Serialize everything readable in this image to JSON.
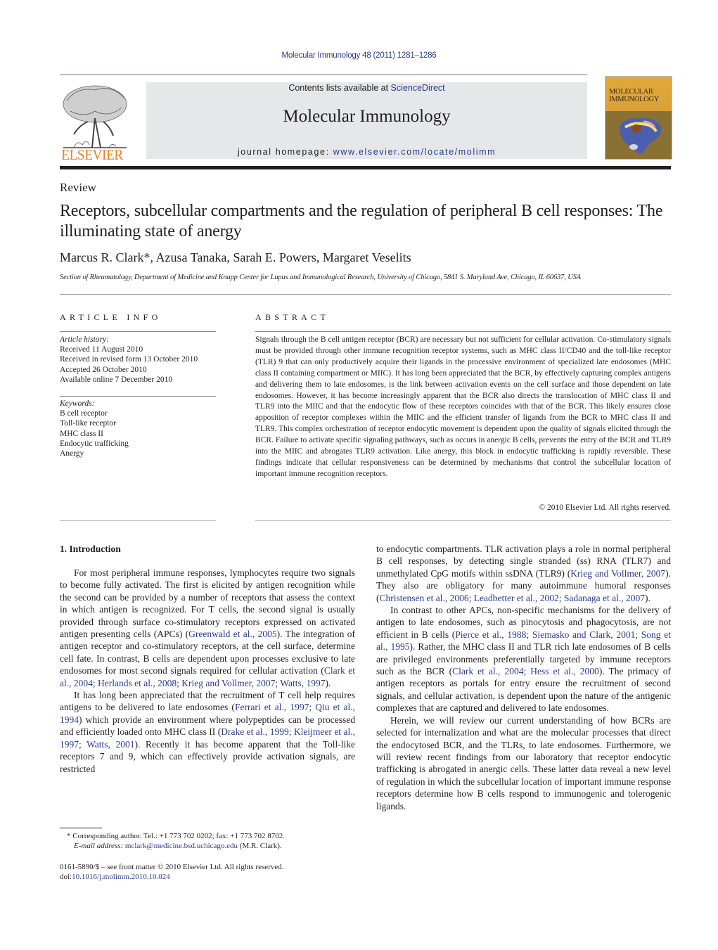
{
  "header": {
    "citation": "Molecular Immunology 48 (2011) 1281–1286",
    "contents_prefix": "Contents lists available at ",
    "contents_link": "ScienceDirect",
    "journal_title": "Molecular Immunology",
    "homepage_prefix": "journal homepage: ",
    "homepage_link": "www.elsevier.com/locate/molimm",
    "publisher_logo_text": "ELSEVIER",
    "cover_title_line1": "MOLECULAR",
    "cover_title_line2": "IMMUNOLOGY",
    "colors": {
      "link": "#2b3a8c",
      "elsevier_orange": "#f08020",
      "banner_bg": "#e6e7e9"
    }
  },
  "article": {
    "type": "Review",
    "title": "Receptors, subcellular compartments and the regulation of peripheral B cell responses: The illuminating state of anergy",
    "authors": [
      {
        "name": "Marcus R. Clark",
        "mark": "*"
      },
      {
        "name": "Azusa Tanaka"
      },
      {
        "name": "Sarah E. Powers"
      },
      {
        "name": "Margaret Veselits"
      }
    ],
    "affiliation": "Section of Rheumatology, Department of Medicine and Knapp Center for Lupus and Immunological Research, University of Chicago, 5841 S. Maryland Ave, Chicago, IL 60637, USA"
  },
  "article_info": {
    "heading": "ARTICLE INFO",
    "history_label": "Article history:",
    "history": [
      "Received 11 August 2010",
      "Received in revised form 13 October 2010",
      "Accepted 26 October 2010",
      "Available online 7 December 2010"
    ],
    "keywords_label": "Keywords:",
    "keywords": [
      "B cell receptor",
      "Toll-like receptor",
      "MHC class II",
      "Endocytic trafficking",
      "Anergy"
    ]
  },
  "abstract": {
    "heading": "ABSTRACT",
    "text": "Signals through the B cell antigen receptor (BCR) are necessary but not sufficient for cellular activation. Co-stimulatory signals must be provided through other immune recognition receptor systems, such as MHC class II/CD40 and the toll-like receptor (TLR) 9 that can only productively acquire their ligands in the processive environment of specialized late endosomes (MHC class II containing compartment or MIIC). It has long been appreciated that the BCR, by effectively capturing complex antigens and delivering them to late endosomes, is the link between activation events on the cell surface and those dependent on late endosomes. However, it has become increasingly apparent that the BCR also directs the translocation of MHC class II and TLR9 into the MIIC and that the endocytic flow of these receptors coincides with that of the BCR. This likely ensures close apposition of receptor complexes within the MIIC and the efficient transfer of ligands from the BCR to MHC class II and TLR9. This complex orchestration of receptor endocytic movement is dependent upon the quality of signals elicited through the BCR. Failure to activate specific signaling pathways, such as occurs in anergic B cells, prevents the entry of the BCR and TLR9 into the MIIC and abrogates TLR9 activation. Like anergy, this block in endocytic trafficking is rapidly reversible. These findings indicate that cellular responsiveness can be determined by mechanisms that control the subcellular location of important immune recognition receptors.",
    "copyright": "© 2010 Elsevier Ltd. All rights reserved."
  },
  "intro": {
    "heading": "1.  Introduction",
    "p1": [
      {
        "t": "For most peripheral immune responses, lymphocytes require two signals to become fully activated. The first is elicited by antigen recognition while the second can be provided by a number of receptors that assess the context in which antigen is recognized. For T cells, the second signal is usually provided through surface co-stimulatory receptors expressed on activated antigen presenting cells (APCs) ("
      },
      {
        "t": "Greenwald et al., 2005",
        "link": true
      },
      {
        "t": "). The integration of antigen receptor and co-stimulatory receptors, at the cell surface, determine cell fate. In contrast, B cells are dependent upon processes exclusive to late endosomes for most second signals required for cellular activation ("
      },
      {
        "t": "Clark et al., 2004; Herlands et al., 2008; Krieg and Vollmer, 2007; Watts, 1997",
        "link": true
      },
      {
        "t": ")."
      }
    ],
    "p2": [
      {
        "t": "It has long been appreciated that the recruitment of T cell help requires antigens to be delivered to late endosomes ("
      },
      {
        "t": "Ferrari et al., 1997; Qiu et al., 1994",
        "link": true
      },
      {
        "t": ") which provide an environment where polypeptides can be processed and efficiently loaded onto MHC class II ("
      },
      {
        "t": "Drake et al., 1999; Kleijmeer et al., 1997; Watts, 2001",
        "link": true
      },
      {
        "t": "). Recently it has become apparent that the Toll-like receptors 7 and 9, which can effectively provide activation signals, are restricted"
      }
    ],
    "p3": [
      {
        "t": "to endocytic compartments. TLR activation plays a role in normal peripheral B cell responses, by detecting single stranded (ss) RNA (TLR7) and unmethylated CpG motifs within ssDNA (TLR9) ("
      },
      {
        "t": "Krieg and Vollmer, 2007",
        "link": true
      },
      {
        "t": "). They also are obligatory for many autoimmune humoral responses ("
      },
      {
        "t": "Christensen et al., 2006; Leadbetter et al., 2002; Sadanaga et al., 2007",
        "link": true
      },
      {
        "t": ")."
      }
    ],
    "p4": [
      {
        "t": "In contrast to other APCs, non-specific mechanisms for the delivery of antigen to late endosomes, such as pinocytosis and phagocytosis, are not efficient in B cells ("
      },
      {
        "t": "Pierce et al., 1988; Siemasko and Clark, 2001; Song et al., 1995",
        "link": true
      },
      {
        "t": "). Rather, the MHC class II and TLR rich late endosomes of B cells are privileged environments preferentially targeted by immune receptors such as the BCR ("
      },
      {
        "t": "Clark et al., 2004; Hess et al., 2000",
        "link": true
      },
      {
        "t": "). The primacy of antigen receptors as portals for entry ensure the recruitment of second signals, and cellular activation, is dependent upon the nature of the antigenic complexes that are captured and delivered to late endosomes."
      }
    ],
    "p5": [
      {
        "t": "Herein, we will review our current understanding of how BCRs are selected for internalization and what are the molecular processes that direct the endocytosed BCR, and the TLRs, to late endosomes. Furthermore, we will review recent findings from our laboratory that receptor endocytic trafficking is abrogated in anergic cells. These latter data reveal a new level of regulation in which the subcellular location of important immune response receptors determine how B cells respond to immunogenic and tolerogenic ligands."
      }
    ]
  },
  "footnote": {
    "mark": "*",
    "corresponding": "Corresponding author. Tel.: +1 773 702 0202; fax: +1 773 702 8702.",
    "email_label": "E-mail address:",
    "email": "mclark@medicine.bsd.uchicago.edu",
    "email_suffix": " (M.R. Clark).",
    "issn_line": "0161-5890/$ – see front matter © 2010 Elsevier Ltd. All rights reserved.",
    "doi_prefix": "doi:",
    "doi": "10.1016/j.molimm.2010.10.024"
  }
}
